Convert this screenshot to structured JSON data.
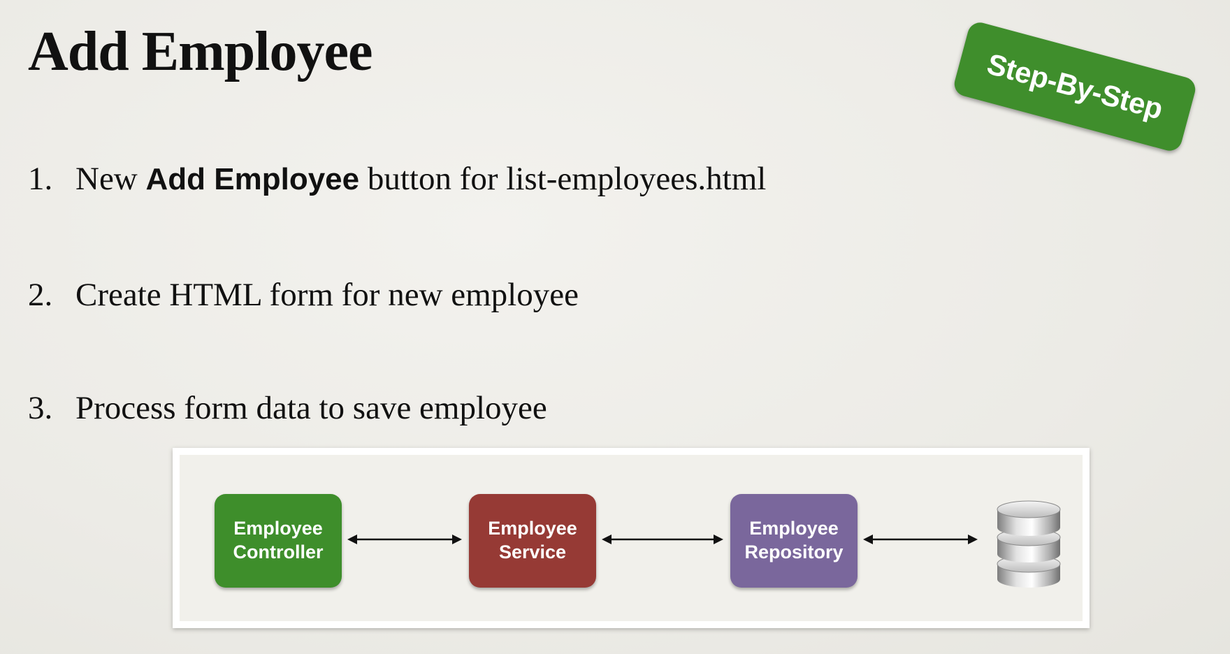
{
  "slide": {
    "title": "Add Employee",
    "badge": "Step-By-Step",
    "steps": [
      {
        "number": "1.",
        "before": "New ",
        "bold": "Add Employee",
        "after": " button for list-employees.html"
      },
      {
        "number": "2.",
        "text": "Create HTML form for new employee"
      },
      {
        "number": "3.",
        "text": "Process form data to save employee"
      }
    ]
  },
  "diagram": {
    "nodes": [
      {
        "line1": "Employee",
        "line2": "Controller",
        "color": "#3e8e2b"
      },
      {
        "line1": "Employee",
        "line2": "Service",
        "color": "#963a35"
      },
      {
        "line1": "Employee",
        "line2": "Repository",
        "color": "#7a679c"
      }
    ],
    "database_icon": "database-icon"
  }
}
